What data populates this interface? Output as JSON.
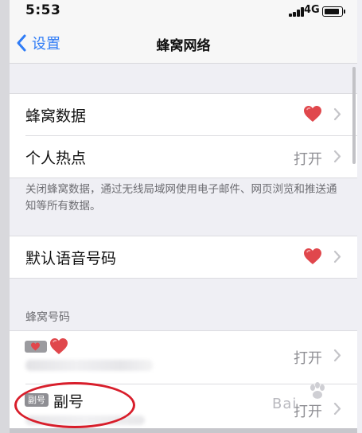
{
  "status_bar": {
    "time": "5:53",
    "network": "4G"
  },
  "nav": {
    "back_label": "设置",
    "title": "蜂窝网络"
  },
  "cells": {
    "cellular_data": {
      "label": "蜂窝数据"
    },
    "hotspot": {
      "label": "个人热点",
      "value": "打开"
    },
    "default_voice": {
      "label": "默认语音号码"
    }
  },
  "footer_note": "关闭蜂窝数据，通过无线局域网使用电子邮件、网页浏览和推送通知等所有数据。",
  "section_header": "蜂窝号码",
  "lines": {
    "primary": {
      "value": "打开"
    },
    "secondary": {
      "badge": "副号",
      "label": "副号",
      "value": "打开"
    }
  },
  "watermark": "Bai",
  "colors": {
    "accent": "#2f7cf6",
    "heart": "#e0474c",
    "highlight_ring": "#d81e2b"
  },
  "icons": [
    "back-chevron-icon",
    "heart-icon",
    "chevron-right-icon",
    "battery-icon",
    "signal-icon"
  ]
}
